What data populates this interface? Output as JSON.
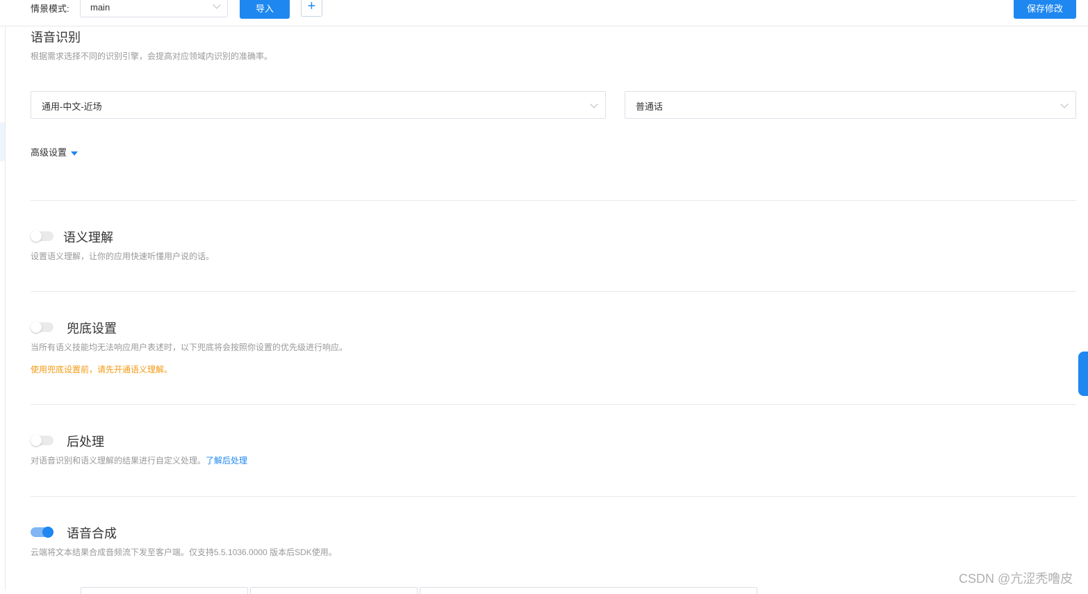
{
  "topbar": {
    "scene_label": "情景模式:",
    "scene_value": "main",
    "import_button": "导入",
    "add_button": "+",
    "save_button": "保存修改"
  },
  "asr": {
    "title": "语音识别",
    "description": "根据需求选择不同的识别引擎，会提高对应领域内识别的准确率。",
    "engine_value": "通用-中文-近场",
    "language_value": "普通话",
    "advanced_label": "高级设置"
  },
  "sections": [
    {
      "id": "nlu",
      "title": "语义理解",
      "enabled": false,
      "description": "设置语义理解，让你的应用快速听懂用户说的话。"
    },
    {
      "id": "fallback",
      "title": "兜底设置",
      "enabled": false,
      "description": "当所有语义技能均无法响应用户表述时，以下兜底将会按照你设置的优先级进行响应。",
      "warning": "使用兜底设置前，请先开通语义理解。"
    },
    {
      "id": "postprocess",
      "title": "后处理",
      "enabled": false,
      "description": "对语音识别和语义理解的结果进行自定义处理。",
      "link": "了解后处理"
    },
    {
      "id": "tts",
      "title": "语音合成",
      "enabled": true,
      "description": "云端将文本结果合成音频流下发至客户端。仅支持5.5.1036.0000 版本后SDK使用。"
    }
  ],
  "colors": {
    "accent": "#1e87f0",
    "warning": "#f39a12"
  },
  "watermark": "CSDN @亢涩秃噜皮"
}
